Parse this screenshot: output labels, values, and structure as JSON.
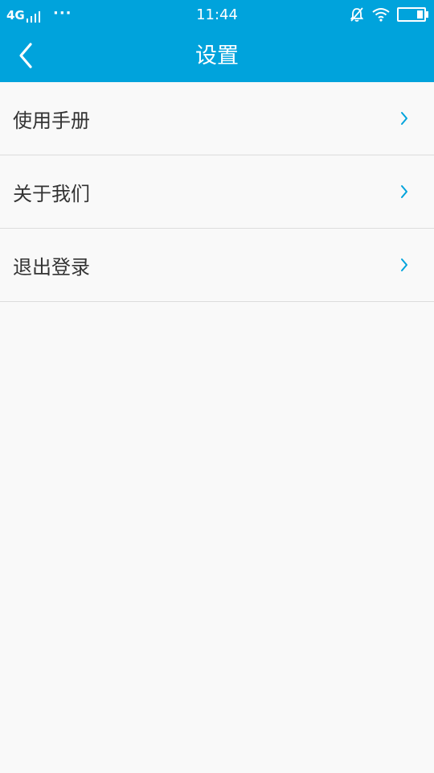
{
  "status_bar": {
    "network": "4G",
    "more": "···",
    "time": "11:44"
  },
  "header": {
    "title": "设置",
    "background_color": "#00a3dc"
  },
  "menu": {
    "items": [
      {
        "label": "使用手册",
        "icon": "chevron-right-icon"
      },
      {
        "label": "关于我们",
        "icon": "chevron-right-icon"
      },
      {
        "label": "退出登录",
        "icon": "chevron-right-icon"
      }
    ],
    "accent_color": "#00a3dc"
  }
}
